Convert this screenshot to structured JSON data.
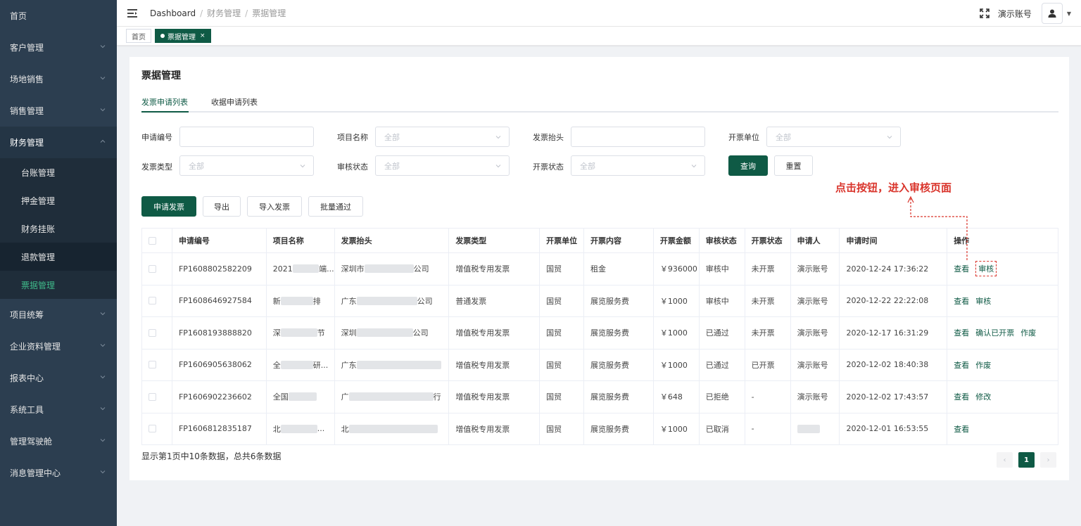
{
  "colors": {
    "primary": "#0f5a45",
    "sidebar": "#2c3e50",
    "annotation": "#d9342b",
    "active_submenu": "#3fb98a"
  },
  "sidebar": {
    "items": [
      {
        "label": "首页",
        "has_children": false
      },
      {
        "label": "客户管理",
        "has_children": true
      },
      {
        "label": "场地销售",
        "has_children": true
      },
      {
        "label": "销售管理",
        "has_children": true
      },
      {
        "label": "财务管理",
        "has_children": true,
        "expanded": true
      },
      {
        "label": "项目统筹",
        "has_children": true
      },
      {
        "label": "企业资料管理",
        "has_children": true
      },
      {
        "label": "报表中心",
        "has_children": true
      },
      {
        "label": "系统工具",
        "has_children": true
      },
      {
        "label": "管理驾驶舱",
        "has_children": true
      },
      {
        "label": "消息管理中心",
        "has_children": true
      }
    ],
    "submenu": [
      {
        "label": "台账管理"
      },
      {
        "label": "押金管理"
      },
      {
        "label": "财务挂账"
      },
      {
        "label": "退款管理"
      },
      {
        "label": "票据管理",
        "current": true
      }
    ]
  },
  "header": {
    "breadcrumb": [
      "Dashboard",
      "财务管理",
      "票据管理"
    ],
    "account_name": "演示账号",
    "icons": [
      "hamburger-icon",
      "fullscreen-icon",
      "user-icon",
      "caret-down-icon"
    ]
  },
  "tagbar": {
    "tags": [
      {
        "label": "首页"
      },
      {
        "label": "票据管理",
        "active": true
      }
    ]
  },
  "page": {
    "title": "票据管理",
    "tabs": [
      {
        "label": "发票申请列表",
        "active": true
      },
      {
        "label": "收据申请列表"
      }
    ],
    "filters": {
      "apply_no": {
        "label": "申请编号",
        "value": ""
      },
      "project_name": {
        "label": "项目名称",
        "value": "全部"
      },
      "invoice_title": {
        "label": "发票抬头",
        "value": ""
      },
      "issuing_unit": {
        "label": "开票单位",
        "value": "全部"
      },
      "invoice_type": {
        "label": "发票类型",
        "value": "全部"
      },
      "review_status": {
        "label": "审核状态",
        "value": "全部"
      },
      "invoice_status": {
        "label": "开票状态",
        "value": "全部"
      }
    },
    "search_button": "查询",
    "reset_button": "重置",
    "actions": {
      "apply": "申请发票",
      "export": "导出",
      "import": "导入发票",
      "batch_approve": "批量通过"
    },
    "annotation": "点击按钮，进入审核页面",
    "table": {
      "columns": [
        "申请编号",
        "项目名称",
        "发票抬头",
        "发票类型",
        "开票单位",
        "开票内容",
        "开票金额",
        "审核状态",
        "开票状态",
        "申请人",
        "申请时间",
        "操作"
      ],
      "rows": [
        {
          "no": "FP1608802582209",
          "project": "2021",
          "project_tail": "端...",
          "title": "深圳市",
          "title_tail": "公司",
          "type": "增值税专用发票",
          "unit": "国贸",
          "content": "租金",
          "amount": "￥936000",
          "review": "审核中",
          "issue": "未开票",
          "applicant": "演示账号",
          "time": "2020-12-24 17:36:22",
          "ops": [
            "查看",
            "审核"
          ]
        },
        {
          "no": "FP1608646927584",
          "project": "新",
          "project_tail": "排",
          "title": "广东",
          "title_tail": "公司",
          "type": "普通发票",
          "unit": "国贸",
          "content": "展览服务费",
          "amount": "￥1000",
          "review": "审核中",
          "issue": "未开票",
          "applicant": "演示账号",
          "time": "2020-12-22 22:22:08",
          "ops": [
            "查看",
            "审核"
          ]
        },
        {
          "no": "FP1608193888820",
          "project": "深",
          "project_tail": "节",
          "title": "深圳",
          "title_tail": "公司",
          "type": "增值税专用发票",
          "unit": "国贸",
          "content": "展览服务费",
          "amount": "￥1000",
          "review": "已通过",
          "issue": "未开票",
          "applicant": "演示账号",
          "time": "2020-12-17 16:31:29",
          "ops": [
            "查看",
            "确认已开票",
            "作废"
          ]
        },
        {
          "no": "FP1606905638062",
          "project": "全",
          "project_tail": "研...",
          "title": "广东",
          "title_tail": "",
          "type": "增值税专用发票",
          "unit": "国贸",
          "content": "展览服务费",
          "amount": "￥1000",
          "review": "已通过",
          "issue": "已开票",
          "applicant": "演示账号",
          "time": "2020-12-02 18:40:38",
          "ops": [
            "查看",
            "作废"
          ]
        },
        {
          "no": "FP1606902236602",
          "project": "全国",
          "project_tail": "",
          "title": "广",
          "title_tail": "行",
          "type": "增值税专用发票",
          "unit": "国贸",
          "content": "展览服务费",
          "amount": "￥648",
          "review": "已拒绝",
          "issue": "-",
          "applicant": "演示账号",
          "time": "2020-12-02 17:43:57",
          "ops": [
            "查看",
            "修改"
          ]
        },
        {
          "no": "FP1606812835187",
          "project": "北",
          "project_tail": "...",
          "title": "北",
          "title_tail": "",
          "type": "增值税专用发票",
          "unit": "国贸",
          "content": "展览服务费",
          "amount": "￥1000",
          "review": "已取消",
          "issue": "-",
          "applicant": "",
          "time": "2020-12-01 16:53:55",
          "ops": [
            "查看"
          ]
        }
      ]
    },
    "footer_text": "显示第1页中10条数据，总共6条数据",
    "pagination": {
      "prev": "‹",
      "current": "1",
      "next": "›"
    }
  }
}
